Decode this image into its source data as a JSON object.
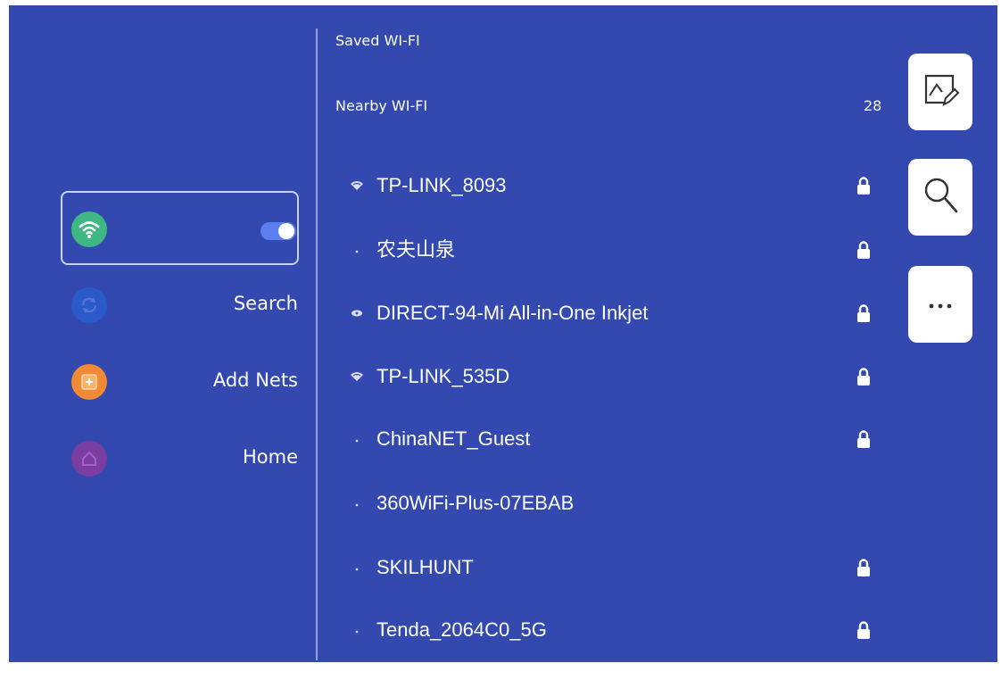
{
  "saved_section": {
    "label": "Saved WI-FI"
  },
  "nearby_section": {
    "label": "Nearby WI-FI",
    "count": "28"
  },
  "sidebar": {
    "wifi_toggle": {
      "enabled": true,
      "icon": "wifi-icon",
      "color": "#3fb883"
    },
    "items": [
      {
        "label": "Search",
        "icon": "refresh-icon",
        "color": "#2a59c9"
      },
      {
        "label": "Add Nets",
        "icon": "add-icon",
        "color": "#f08a34"
      },
      {
        "label": "Home",
        "icon": "home-icon",
        "color": "#7a3ea0"
      }
    ]
  },
  "networks": [
    {
      "name": "TP-LINK_8093",
      "signal": "wifi",
      "locked": true
    },
    {
      "name": "农夫山泉",
      "signal": "dot",
      "locked": true
    },
    {
      "name": "DIRECT-94-Mi All-in-One Inkjet",
      "signal": "eye",
      "locked": true
    },
    {
      "name": "TP-LINK_535D",
      "signal": "wifi",
      "locked": true
    },
    {
      "name": "ChinaNET_Guest",
      "signal": "dot",
      "locked": true
    },
    {
      "name": "360WiFi-Plus-07EBAB",
      "signal": "dot",
      "locked": false
    },
    {
      "name": "SKILHUNT",
      "signal": "dot",
      "locked": true
    },
    {
      "name": "Tenda_2064C0_5G",
      "signal": "dot",
      "locked": true
    }
  ],
  "side_buttons": [
    {
      "icon": "image-edit-icon"
    },
    {
      "icon": "search-icon"
    },
    {
      "icon": "more-icon"
    }
  ],
  "colors": {
    "background": "#3349b0",
    "toggle": "#5b7ff0",
    "text": "#ffffff"
  }
}
